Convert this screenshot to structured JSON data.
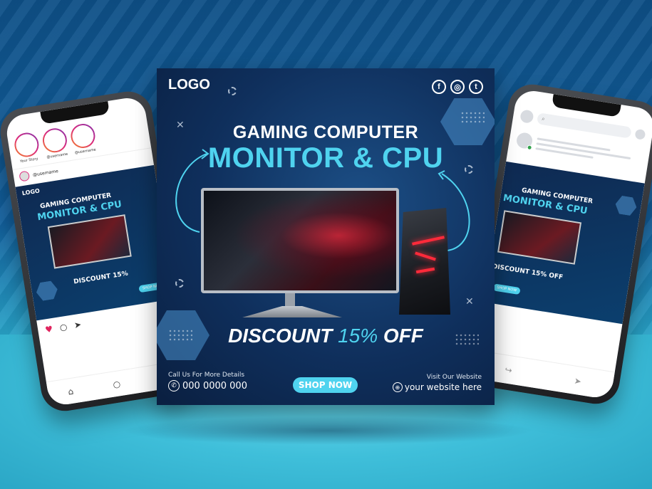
{
  "post": {
    "logo": "LOGO",
    "social": [
      {
        "name": "facebook-icon",
        "glyph": "f"
      },
      {
        "name": "instagram-icon",
        "glyph": "◎"
      },
      {
        "name": "twitter-icon",
        "glyph": "t"
      }
    ],
    "title_line1": "GAMING COMPUTER",
    "title_line2": "MONITOR & CPU",
    "discount_word": "DISCOUNT",
    "discount_pct": "15%",
    "discount_off": "OFF",
    "call_label": "Call Us For More Details",
    "phone_number": "000 0000 000",
    "shop_button": "SHOP NOW",
    "visit_label": "Visit Our Website",
    "website": "your website here"
  },
  "left_phone": {
    "stories": [
      {
        "label": "Your Story"
      },
      {
        "label": "@username"
      },
      {
        "label": "@username"
      }
    ],
    "username": "@username",
    "mini_logo": "LOGO",
    "mini_title1": "GAMING COMPUTER",
    "mini_title2": "MONITOR & CPU",
    "mini_discount": "DISCOUNT 15%",
    "mini_shop": "SHOP NOW"
  },
  "right_phone": {
    "mini_title1": "GAMING COMPUTER",
    "mini_title2": "MONITOR & CPU",
    "mini_discount": "DISCOUNT 15% OFF",
    "mini_shop": "SHOP NOW"
  },
  "colors": {
    "accent": "#4fd3ef",
    "post_bg": "#0f2f5c",
    "background": "#12609e",
    "floor": "#43c6de"
  }
}
